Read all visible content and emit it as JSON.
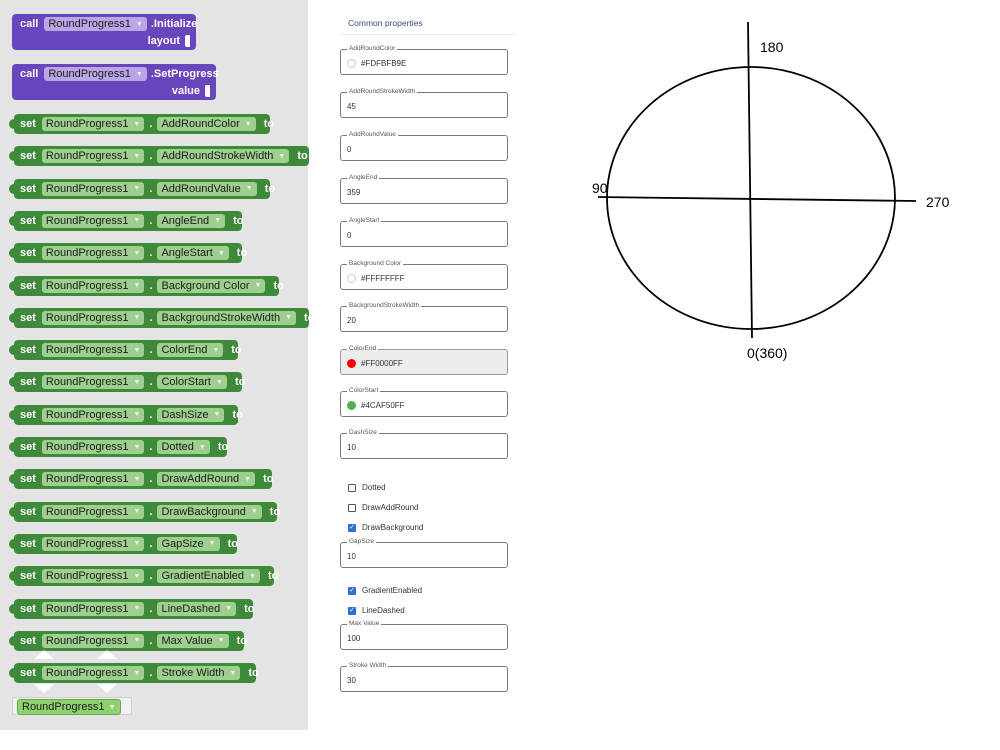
{
  "workspace": {
    "call_blocks": [
      {
        "keyword": "call",
        "component": "RoundProgress1",
        "method": ".Initialize",
        "param": "layout"
      },
      {
        "keyword": "call",
        "component": "RoundProgress1",
        "method": ".SetProgress",
        "param": "value"
      }
    ],
    "set_blocks": [
      {
        "keyword": "set",
        "component": "RoundProgress1",
        "dot": ".",
        "property": "AddRoundColor",
        "to": "to"
      },
      {
        "keyword": "set",
        "component": "RoundProgress1",
        "dot": ".",
        "property": "AddRoundStrokeWidth",
        "to": "to"
      },
      {
        "keyword": "set",
        "component": "RoundProgress1",
        "dot": ".",
        "property": "AddRoundValue",
        "to": "to"
      },
      {
        "keyword": "set",
        "component": "RoundProgress1",
        "dot": ".",
        "property": "AngleEnd",
        "to": "to"
      },
      {
        "keyword": "set",
        "component": "RoundProgress1",
        "dot": ".",
        "property": "AngleStart",
        "to": "to"
      },
      {
        "keyword": "set",
        "component": "RoundProgress1",
        "dot": ".",
        "property": "Background Color",
        "to": "to"
      },
      {
        "keyword": "set",
        "component": "RoundProgress1",
        "dot": ".",
        "property": "BackgroundStrokeWidth",
        "to": "to"
      },
      {
        "keyword": "set",
        "component": "RoundProgress1",
        "dot": ".",
        "property": "ColorEnd",
        "to": "to"
      },
      {
        "keyword": "set",
        "component": "RoundProgress1",
        "dot": ".",
        "property": "ColorStart",
        "to": "to"
      },
      {
        "keyword": "set",
        "component": "RoundProgress1",
        "dot": ".",
        "property": "DashSize",
        "to": "to"
      },
      {
        "keyword": "set",
        "component": "RoundProgress1",
        "dot": ".",
        "property": "Dotted",
        "to": "to"
      },
      {
        "keyword": "set",
        "component": "RoundProgress1",
        "dot": ".",
        "property": "DrawAddRound",
        "to": "to"
      },
      {
        "keyword": "set",
        "component": "RoundProgress1",
        "dot": ".",
        "property": "DrawBackground",
        "to": "to"
      },
      {
        "keyword": "set",
        "component": "RoundProgress1",
        "dot": ".",
        "property": "GapSize",
        "to": "to"
      },
      {
        "keyword": "set",
        "component": "RoundProgress1",
        "dot": ".",
        "property": "GradientEnabled",
        "to": "to"
      },
      {
        "keyword": "set",
        "component": "RoundProgress1",
        "dot": ".",
        "property": "LineDashed",
        "to": "to"
      },
      {
        "keyword": "set",
        "component": "RoundProgress1",
        "dot": ".",
        "property": "Max Value",
        "to": "to"
      },
      {
        "keyword": "set",
        "component": "RoundProgress1",
        "dot": ".",
        "property": "Stroke Width",
        "to": "to"
      }
    ],
    "component_block": {
      "label": "RoundProgress1"
    },
    "colors": {
      "set_block": "#3f8a3a",
      "call_block": "#6a46bc",
      "chip": "#9ecf8e"
    }
  },
  "properties": {
    "header": "Common properties",
    "fields": [
      {
        "label": "AddRoundColor",
        "value": "#FDFBFB9E",
        "swatch": "#FDFBFB"
      },
      {
        "label": "AddRoundStrokeWidth",
        "value": "45"
      },
      {
        "label": "AddRoundValue",
        "value": "0"
      },
      {
        "label": "AngleEnd",
        "value": "359"
      },
      {
        "label": "AngleStart",
        "value": "0"
      },
      {
        "label": "Background Color",
        "value": "#FFFFFFFF",
        "swatch": "#FFFFFF"
      },
      {
        "label": "BackgroundStrokeWidth",
        "value": "20"
      },
      {
        "label": "ColorEnd",
        "value": "#FF0000FF",
        "swatch": "#FF0000",
        "disabled": true
      },
      {
        "label": "ColorStart",
        "value": "#4CAF50FF",
        "swatch": "#4CAF50"
      },
      {
        "label": "DashSize",
        "value": "10"
      },
      {
        "label": "GapSize",
        "value": "10"
      },
      {
        "label": "Max Value",
        "value": "100"
      },
      {
        "label": "Stroke Width",
        "value": "30"
      }
    ],
    "checkboxes": [
      {
        "label": "Dotted",
        "checked": false
      },
      {
        "label": "DrawAddRound",
        "checked": false
      },
      {
        "label": "DrawBackground",
        "checked": true
      },
      {
        "label": "GradientEnabled",
        "checked": true
      },
      {
        "label": "LineDashed",
        "checked": true
      }
    ]
  },
  "diagram": {
    "label_top": "180",
    "label_left": "90",
    "label_right": "270",
    "label_bottom": "0(360)"
  }
}
